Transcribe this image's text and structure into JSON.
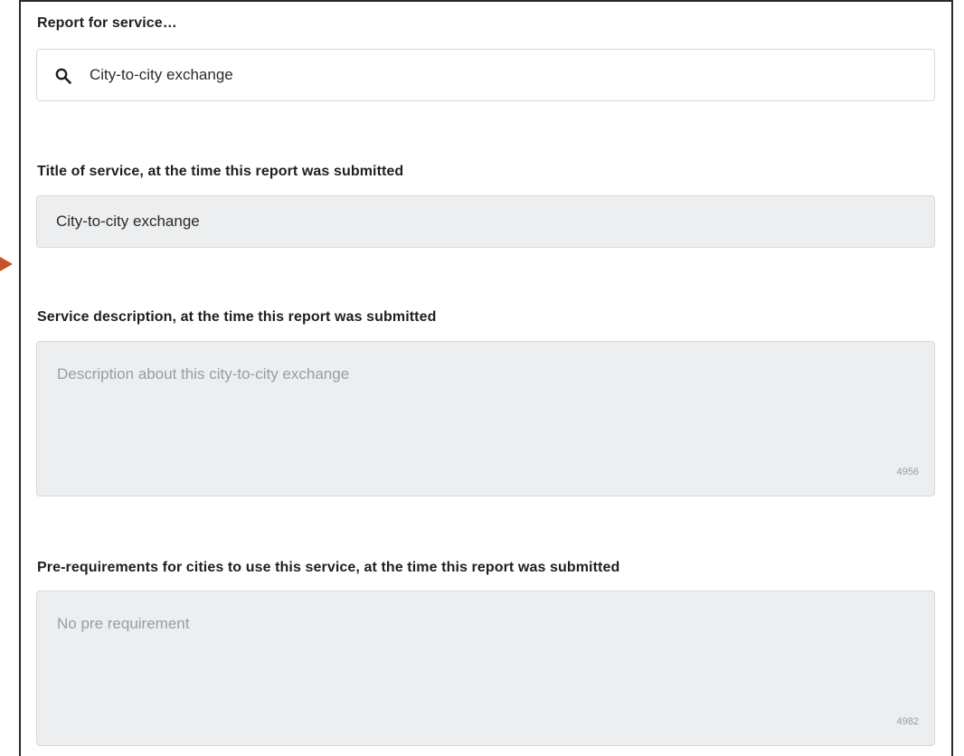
{
  "service_search": {
    "label": "Report for service…",
    "value": "City-to-city exchange",
    "icon": "search-icon"
  },
  "title_field": {
    "label": "Title of service, at the time this report was submitted",
    "value": "City-to-city exchange"
  },
  "description_field": {
    "label": "Service description, at the time this report was submitted",
    "placeholder": "Description about this city-to-city exchange",
    "counter": "4956"
  },
  "prerequirements_field": {
    "label": "Pre-requirements for cities to use this service, at the time this report was submitted",
    "placeholder": "No pre requirement",
    "counter": "4982"
  },
  "colors": {
    "accent_arrow": "#c5532b",
    "readonly_background": "#eceef0",
    "placeholder_text": "#9a9c9e"
  }
}
